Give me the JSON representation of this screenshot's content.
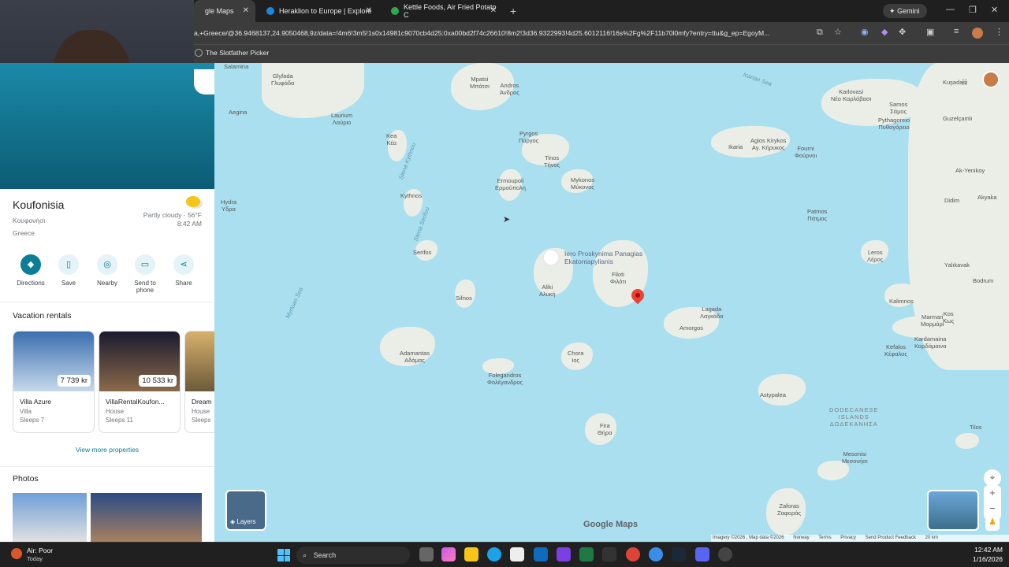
{
  "browser": {
    "tabs": [
      {
        "title": "gle Maps",
        "active": true
      },
      {
        "title": "Heraklion to Europe | Explore",
        "active": false
      },
      {
        "title": "Kettle Foods, Air Fried Potato C",
        "active": false
      }
    ],
    "new_tab": "+",
    "gemini_label": "Gemini",
    "url": "a,+Greece/@36.9468137,24.9050468,9z/data=!4m6!3m5!1s0x14981c9070cb4d25:0xa00bd2f74c26610!8m2!3d36.9322993!4d25.6012116!16s%2Fg%2F11b70l0mfy?entry=ttu&g_ep=EgoyM...",
    "bookmark": "The Slotfather Picker"
  },
  "place": {
    "name": "Koufonisia",
    "native_name": "Κουφονήσι",
    "country": "Greece",
    "weather": "Partly cloudy · 56°F",
    "time": "8:42 AM",
    "actions": [
      "Directions",
      "Save",
      "Nearby",
      "Send to phone",
      "Share"
    ]
  },
  "vacation": {
    "title": "Vacation rentals",
    "rentals": [
      {
        "name": "Villa Azure",
        "price": "7 739 kr",
        "type": "Villa",
        "sleeps": "Sleeps 7"
      },
      {
        "name": "VillaRentalKoufon...",
        "price": "10 533 kr",
        "type": "House",
        "sleeps": "Sleeps 11"
      },
      {
        "name": "Dream",
        "type": "House",
        "sleeps": "Sleeps"
      }
    ],
    "more": "View more properties"
  },
  "photos": {
    "title": "Photos"
  },
  "map": {
    "pin_label_1": "Iero Proskynima Panagias",
    "pin_label_2": "Ekatontapylianis",
    "labels": [
      "Salamina",
      "Glyfada\nΓλυφάδα",
      "Aegina",
      "Laurium\nΛαύριο",
      "Mpatsi\nΜπάτσι",
      "Andros\nΆνδρος",
      "Pyrgos\nΠύργος",
      "Tinos\nΤήνος",
      "Kea\nΚέα",
      "Ermoupoli\nΕρμούπολη",
      "Mykonos\nΜύκονος",
      "Kythnos",
      "Hydra\nΥδρα",
      "Serifos",
      "Sifnos",
      "Aliki\nΑλυκή",
      "Filoti\nΦιλότι",
      "Lagada\nΛαγκάδα",
      "Amorgos",
      "Chora\nΙος",
      "Adamantas\nΑδάμας",
      "Folegandros\nΦολέγανδρος",
      "Fira\nΘήρα",
      "Astypalea",
      "Ikaria",
      "Agios Kirykos\nΑγ. Κήρυκος",
      "Fourni\nΦούρνοι",
      "Karlovasi\nΝέο Καρλόβασι",
      "Samos\nΣάμος",
      "Pythagoreio\nΠυθαγόρειο",
      "Guzelçamlı",
      "Patmos\nΠάτμος",
      "Leros\nΛέρος",
      "Kalimnos",
      "Kefalos\nΚέφαλος",
      "Marmari\nΜαρμάρι",
      "Kos\nΚως",
      "Kardamaina\nΚαρδάμαινα",
      "Yalıkavak",
      "Bodrum",
      "Akyaka",
      "Didim",
      "Ak-Yenikoy",
      "Tilos",
      "Mesonisi\nΜεσονήσι",
      "Zaforas\nΖαφοράς",
      "Kuşadası",
      "DODECANESE\nISLANDS\nΔΩΔΕΚΑΝΗΣΑ"
    ],
    "seas": [
      "Icarian Sea",
      "Myrtoan Sea",
      "Stena Kythnou",
      "Stena Serifou"
    ],
    "branding": "Google Maps",
    "layers": "Layers",
    "footer": [
      "Imagery ©2026 , Map data ©2026",
      "Norway",
      "Terms",
      "Privacy",
      "Send Product Feedback",
      "20 km"
    ]
  },
  "taskbar": {
    "weather": "Air: Poor",
    "weather_sub": "Today",
    "search": "Search",
    "time": "12:42 AM",
    "date": "1/16/2026"
  }
}
